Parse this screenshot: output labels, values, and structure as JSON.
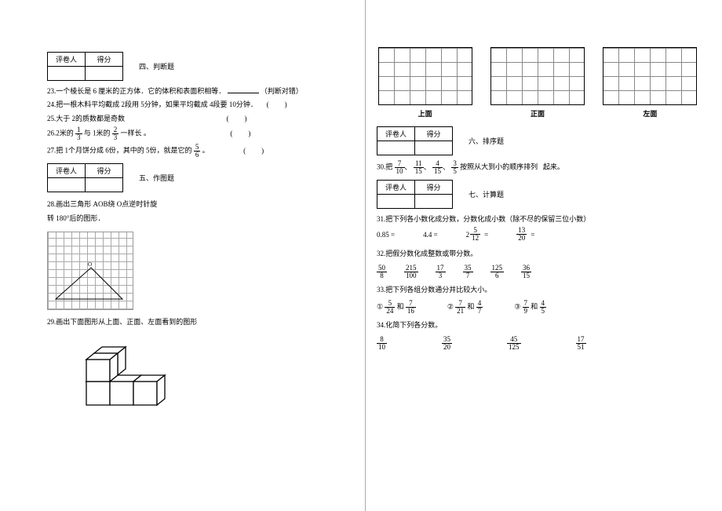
{
  "score_header": {
    "scorer_label": "评卷人",
    "score_label": "得分"
  },
  "sections": {
    "s4": "四、判断题",
    "s5": "五、作图题",
    "s6": "六、排序题",
    "s7": "七、计算题"
  },
  "q23": {
    "num": "23.",
    "text_a": "一个棱长是",
    "val": "6",
    "text_b": "厘米的正方体．它的体积和表面积相等．",
    "tail": "（判断对错）"
  },
  "q24": {
    "num": "24.",
    "text": "把一根木料平均截成",
    "v1": "2",
    "t2": "段用",
    "v2": "5",
    "t3": "分钟，如果平均截成",
    "v3": "4",
    "t4": "段要",
    "v4": "10",
    "t5": "分钟．"
  },
  "q25": {
    "num": "25.",
    "text": "大于",
    "v": "2",
    "t2": "的质数都是奇数"
  },
  "q26": {
    "num": "26.",
    "v1": "2",
    "t1": "米的",
    "f1n": "1",
    "f1d": "3",
    "t2": "与",
    "v2": "1",
    "t3": "米的",
    "f2n": "2",
    "f2d": "3",
    "t4": "一样长",
    "dot": "。"
  },
  "q27": {
    "num": "27.",
    "t1": "把",
    "v1": "1",
    "t2": "个月饼分成",
    "v2": "6",
    "t3": "份，其中的",
    "v3": "5",
    "t4": "份，就是它的",
    "fn": "5",
    "fd": "6",
    "dot": "。"
  },
  "q28": {
    "num": "28.",
    "text": "画出三角形",
    "aob": "AOB",
    "t2": "绕",
    "o": "O",
    "t3": "点逆时针旋",
    "t4": "转",
    "deg": "180°",
    "t5": "后的图形．"
  },
  "q29": {
    "num": "29.",
    "text": "画出下面图形从上面、正面、左面看到的图形"
  },
  "views": {
    "top": "上面",
    "front": "正面",
    "left": "左面"
  },
  "q30": {
    "num": "30.",
    "t1": "把",
    "fracs": [
      {
        "n": "7",
        "d": "10"
      },
      {
        "n": "11",
        "d": "15"
      },
      {
        "n": "4",
        "d": "15"
      },
      {
        "n": "3",
        "d": "5"
      }
    ],
    "sep": "、",
    "t2": "按照从大到小的顺序排列",
    "sp": "起来。"
  },
  "q31": {
    "num": "31.",
    "text": "把下列各小数化成分数，分数化成小数（除不尽的保留三位小数）"
  },
  "q31b": {
    "a": "0.85 =",
    "b": "4.4 =",
    "c_whole": "2",
    "c_n": "5",
    "c_d": "12",
    "eq": "=",
    "dn": "13",
    "dd": "20",
    "deq": "="
  },
  "q32": {
    "num": "32.",
    "text": "把假分数化成整数或带分数。"
  },
  "q32_fracs": [
    {
      "n": "50",
      "d": "8"
    },
    {
      "n": "215",
      "d": "100"
    },
    {
      "n": "17",
      "d": "3"
    },
    {
      "n": "35",
      "d": "7"
    },
    {
      "n": "125",
      "d": "6"
    },
    {
      "n": "36",
      "d": "15"
    }
  ],
  "q33": {
    "num": "33.",
    "text": "把下列各组分数通分并比较大小。"
  },
  "q33_groups": [
    {
      "lbl": "①",
      "a": {
        "n": "5",
        "d": "24"
      },
      "and": "和",
      "b": {
        "n": "7",
        "d": "16"
      }
    },
    {
      "lbl": "②",
      "a": {
        "n": "7",
        "d": "21"
      },
      "and": "和",
      "b": {
        "n": "4",
        "d": "7"
      }
    },
    {
      "lbl": "③",
      "a": {
        "n": "7",
        "d": "9"
      },
      "and": "和",
      "b": {
        "n": "4",
        "d": "5"
      }
    }
  ],
  "q34": {
    "num": "34.",
    "text": "化简下列各分数。"
  },
  "q34_fracs": [
    {
      "n": "8",
      "d": "10"
    },
    {
      "n": "35",
      "d": "20"
    },
    {
      "n": "45",
      "d": "125"
    },
    {
      "n": "17",
      "d": "51"
    }
  ]
}
